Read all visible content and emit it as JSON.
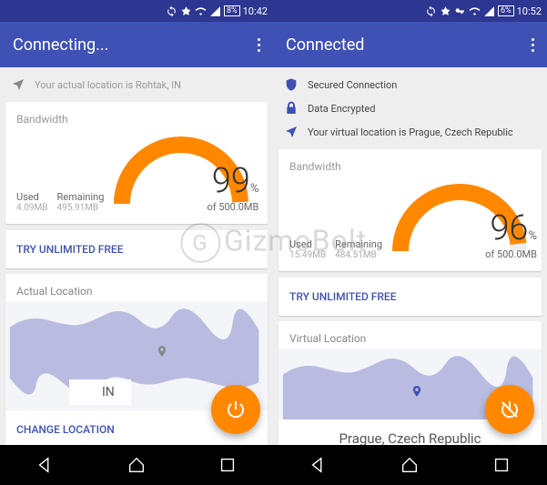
{
  "watermark": "GizmoBolt",
  "left": {
    "status": {
      "battery": "8%",
      "time": "10:42"
    },
    "appbar": {
      "title": "Connecting..."
    },
    "info": {
      "actual_location_line": "Your actual location is Rohtak, IN"
    },
    "bandwidth": {
      "title": "Bandwidth",
      "used_label": "Used",
      "used_value": "4.09MB",
      "remaining_label": "Remaining",
      "remaining_value": "495.91MB",
      "percent": "99",
      "percent_unit": "%",
      "of_line": "of 500.0MB",
      "try_link": "TRY UNLIMITED FREE"
    },
    "location_card": {
      "title": "Actual Location",
      "country_code": "IN",
      "change_link": "CHANGE LOCATION"
    }
  },
  "right": {
    "status": {
      "battery": "6%",
      "time": "10:52"
    },
    "appbar": {
      "title": "Connected"
    },
    "info": {
      "secured": "Secured Connection",
      "encrypted": "Data Encrypted",
      "virtual_location_line": "Your virtual location is Prague, Czech Republic"
    },
    "bandwidth": {
      "title": "Bandwidth",
      "used_label": "Used",
      "used_value": "15.49MB",
      "remaining_label": "Remaining",
      "remaining_value": "484.51MB",
      "percent": "96",
      "percent_unit": "%",
      "of_line": "of 500.0MB",
      "try_link": "TRY UNLIMITED FREE"
    },
    "location_card": {
      "title": "Virtual Location",
      "location_name": "Prague, Czech Republic"
    }
  },
  "chart_data": [
    {
      "type": "gauge",
      "title": "Bandwidth",
      "value": 99,
      "max": 100,
      "unit": "%",
      "used_mb": 4.09,
      "remaining_mb": 495.91,
      "total_mb": 500.0
    },
    {
      "type": "gauge",
      "title": "Bandwidth",
      "value": 96,
      "max": 100,
      "unit": "%",
      "used_mb": 15.49,
      "remaining_mb": 484.51,
      "total_mb": 500.0
    }
  ]
}
